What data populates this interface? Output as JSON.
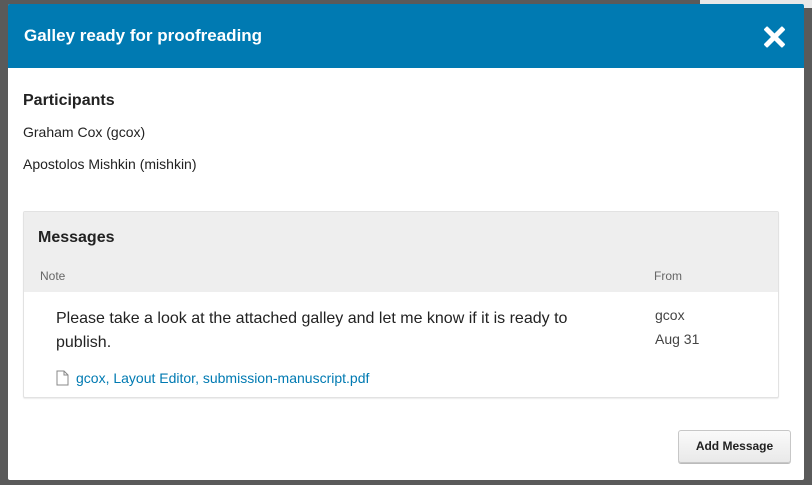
{
  "modal": {
    "title": "Galley ready for proofreading"
  },
  "participants": {
    "heading": "Participants",
    "people": [
      "Graham Cox (gcox)",
      "Apostolos Mishkin (mishkin)"
    ]
  },
  "messages": {
    "heading": "Messages",
    "columns": {
      "note": "Note",
      "from": "From"
    },
    "items": [
      {
        "text": "Please take a look at the attached galley and let me know if it is ready to publish.",
        "from_user": "gcox",
        "from_date": "Aug 31",
        "attachment": "gcox, Layout Editor, submission-manuscript.pdf"
      }
    ]
  },
  "actions": {
    "add_message": "Add Message"
  },
  "colors": {
    "header_bg": "#007ab2",
    "link": "#007ab2"
  }
}
